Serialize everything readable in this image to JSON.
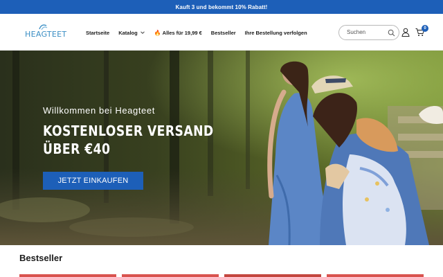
{
  "announcement": "Kauft 3 und bekommt 10% Rabatt!",
  "logo": {
    "text": "HEAGTEET"
  },
  "nav": {
    "items": [
      {
        "label": "Startseite"
      },
      {
        "label": "Katalog"
      },
      {
        "label": "Alles für 19,99 €"
      },
      {
        "label": "Bestseller"
      },
      {
        "label": "Ihre Bestellung verfolgen"
      }
    ]
  },
  "search": {
    "placeholder": "Suchen"
  },
  "cart": {
    "count": "0"
  },
  "hero": {
    "subtitle": "Willkommen bei Heagteet",
    "title_line1": "KOSTENLOSER VERSAND",
    "title_line2": "ÜBER €40",
    "button": "JETZT EINKAUFEN"
  },
  "section": {
    "title": "Bestseller"
  },
  "colors": {
    "brand_blue": "#1d5fb8",
    "logo_blue": "#3a8ec4"
  }
}
